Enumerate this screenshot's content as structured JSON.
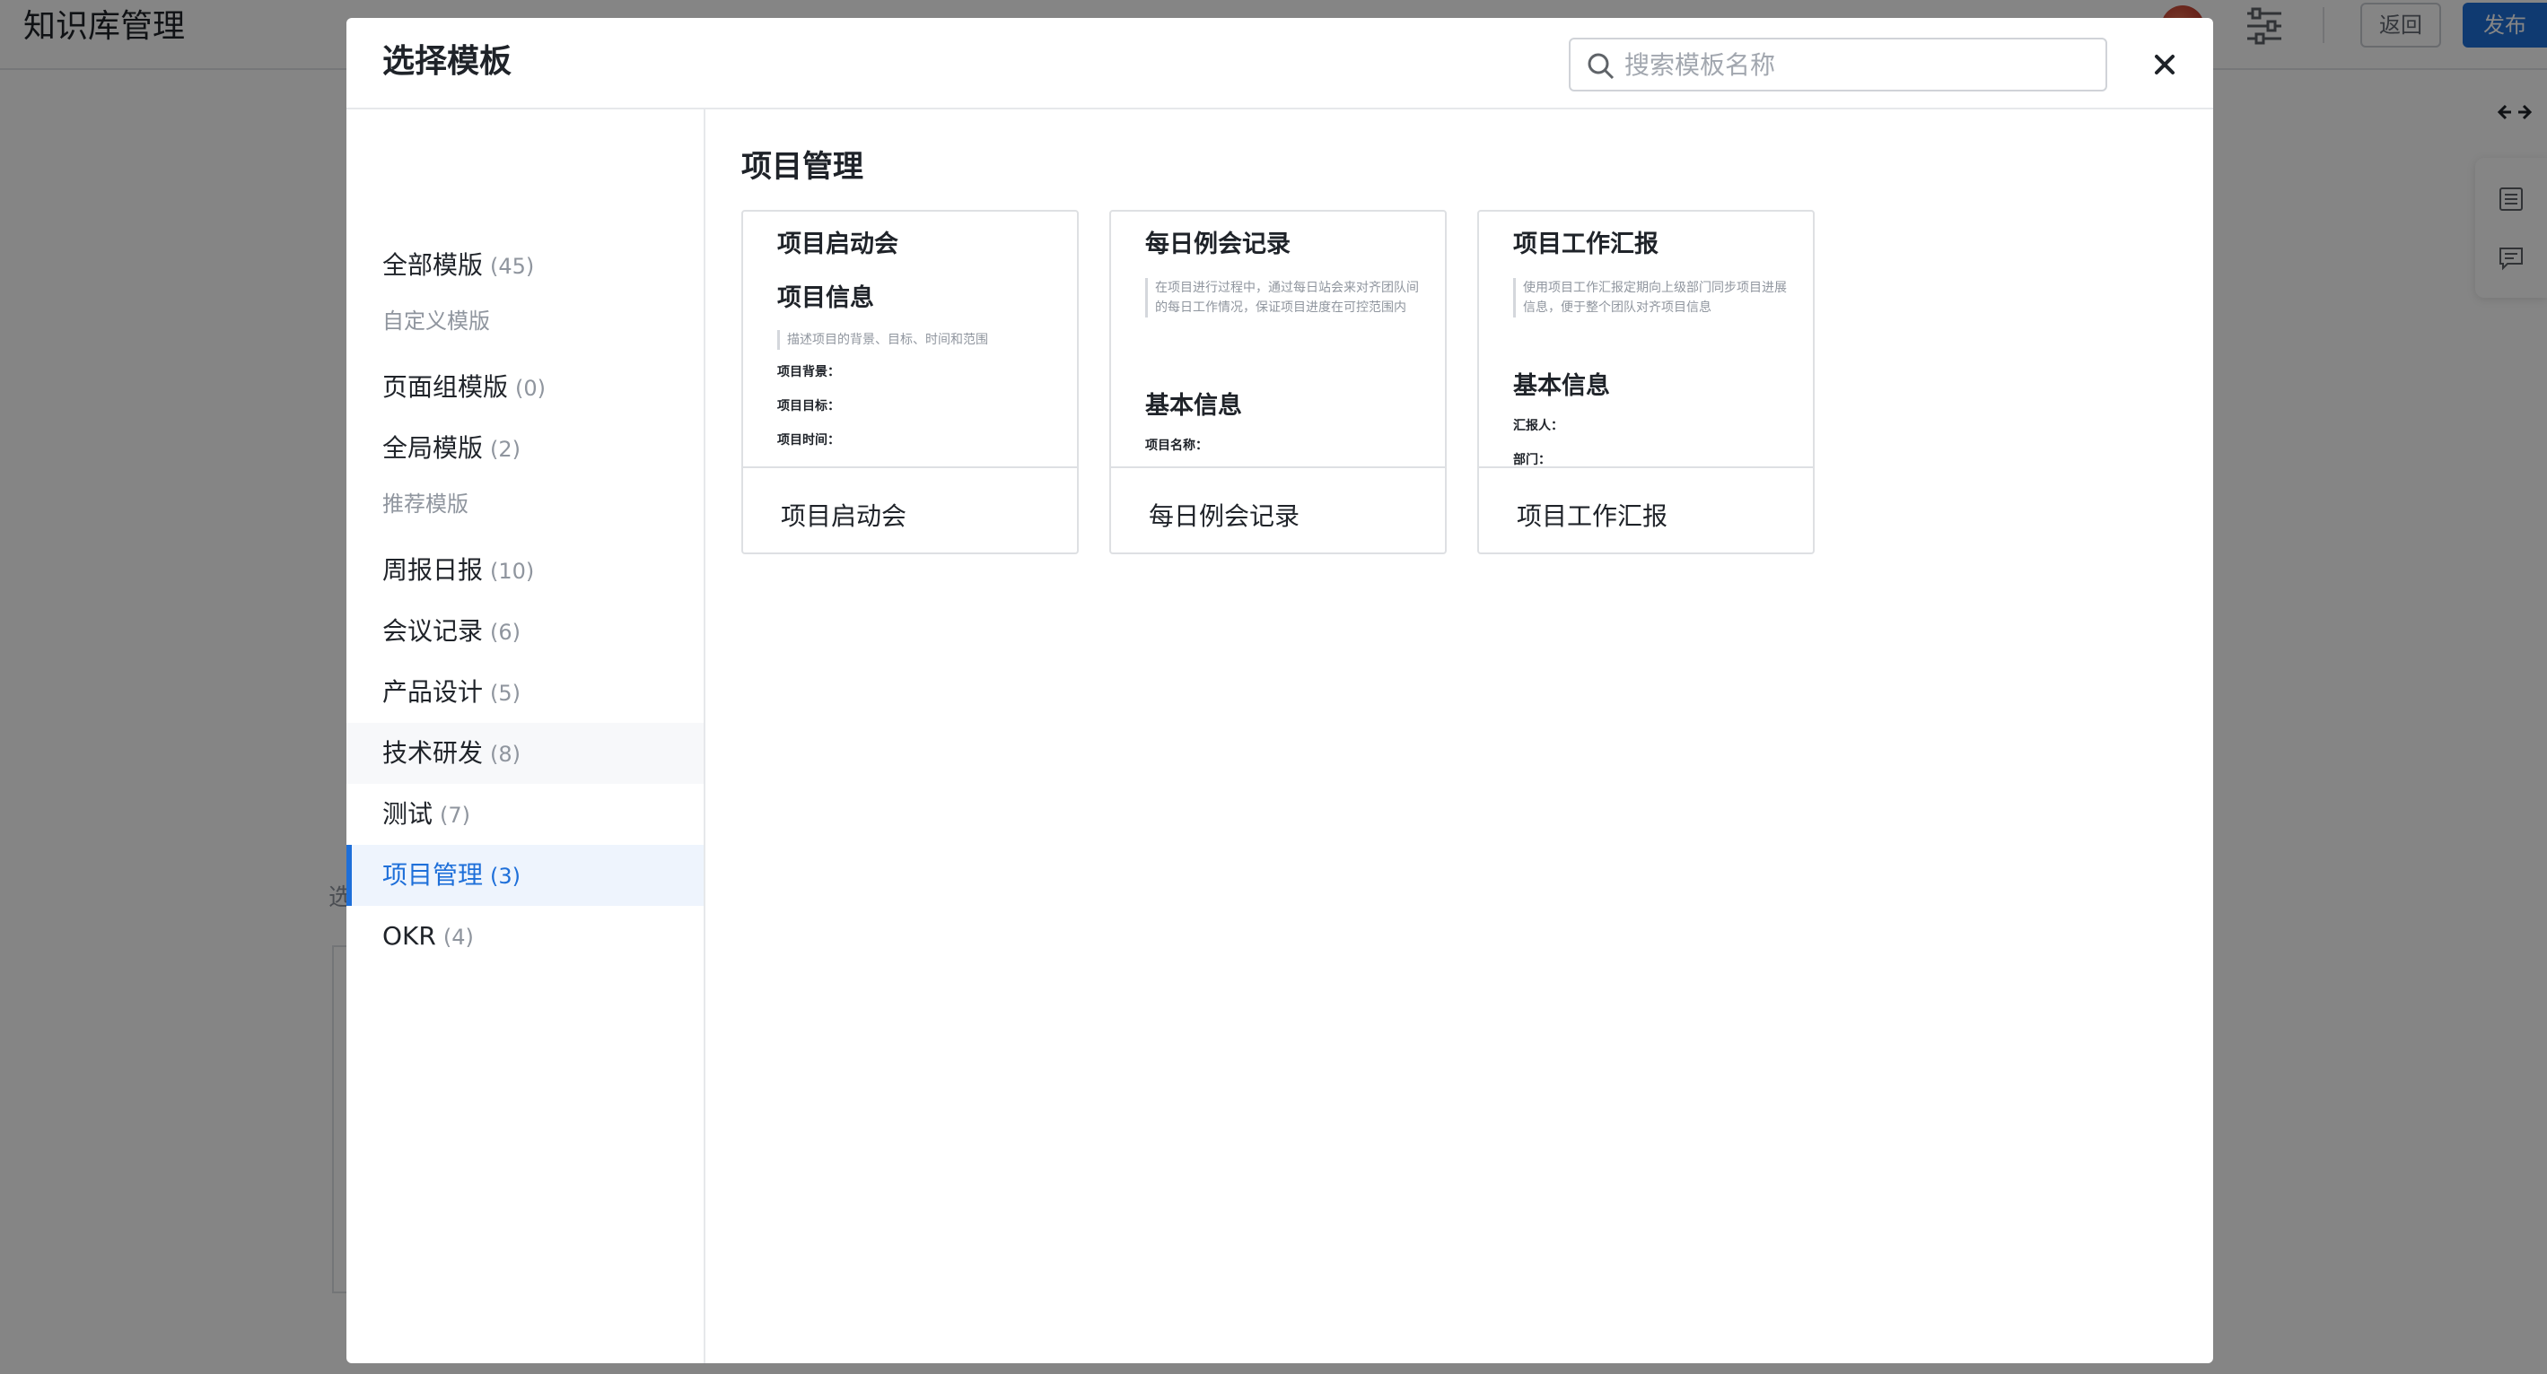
{
  "app": {
    "title": "知识库管理",
    "back_label": "返回",
    "publish_label": "发布"
  },
  "modal": {
    "title": "选择模板",
    "search_placeholder": "搜索模板名称",
    "all_templates": {
      "label": "全部模版",
      "count": "(45)"
    },
    "groups": {
      "custom": "自定义模版",
      "recommended": "推荐模版"
    },
    "custom_items": [
      {
        "label": "页面组模版",
        "count": "(0)"
      },
      {
        "label": "全局模版",
        "count": "(2)"
      }
    ],
    "recommended_items": [
      {
        "label": "周报日报",
        "count": "(10)"
      },
      {
        "label": "会议记录",
        "count": "(6)"
      },
      {
        "label": "产品设计",
        "count": "(5)"
      },
      {
        "label": "技术研发",
        "count": "(8)"
      },
      {
        "label": "测试",
        "count": "(7)"
      },
      {
        "label": "项目管理",
        "count": "(3)"
      },
      {
        "label": "OKR",
        "count": "(4)"
      }
    ],
    "active_category": "项目管理",
    "content_title": "项目管理",
    "cards": [
      {
        "name": "项目启动会",
        "preview": {
          "title": "项目启动会",
          "heading": "项目信息",
          "desc": "描述项目的背景、目标、时间和范围",
          "fields": [
            "项目背景：",
            "项目目标：",
            "项目时间："
          ]
        }
      },
      {
        "name": "每日例会记录",
        "preview": {
          "title": "每日例会记录",
          "desc": "在项目进行过程中，通过每日站会来对齐团队间的每日工作情况，保证项目进度在可控范围内",
          "heading": "基本信息",
          "fields": [
            "项目名称："
          ]
        }
      },
      {
        "name": "项目工作汇报",
        "preview": {
          "title": "项目工作汇报",
          "desc": "使用项目工作汇报定期向上级部门同步项目进展信息，便于整个团队对齐项目信息",
          "heading": "基本信息",
          "fields": [
            "汇报人：",
            "部门："
          ]
        }
      }
    ]
  },
  "icons": {
    "search": "search-icon",
    "close": "close-icon",
    "settings": "sliders-icon",
    "expand": "expand-horizontal-icon",
    "outline": "outline-list-icon",
    "comment": "comment-icon"
  },
  "colors": {
    "accent": "#1e6fd9",
    "active_bg": "#eef4fd",
    "overlay": "rgba(0,0,0,0.48)"
  }
}
